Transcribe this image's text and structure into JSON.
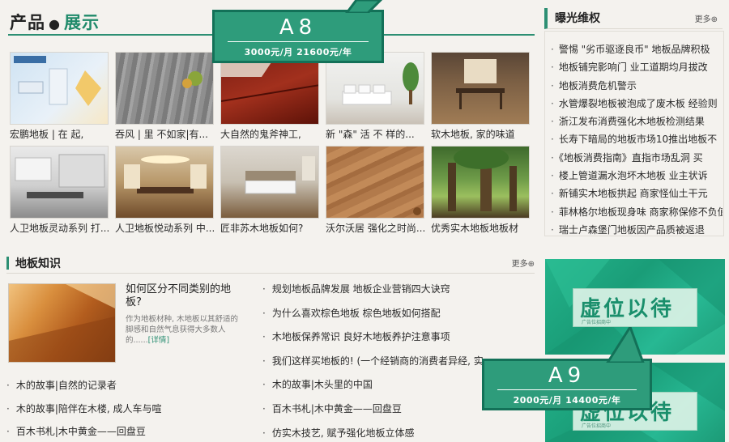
{
  "products": {
    "title_part1": "产品",
    "title_dot": "●",
    "title_part2": "展示",
    "items": [
      {
        "caption": "宏鹏地板 | 在  起,",
        "image": "room-photo-1"
      },
      {
        "caption": "吞风 | 里 不如家|有...",
        "image": "grey-wood-planks"
      },
      {
        "caption": "大自然的鬼斧神工,",
        "image": "red-wood-floor"
      },
      {
        "caption": "新 \"森\" 活 不 样的...",
        "image": "white-living-room"
      },
      {
        "caption": "软木地板, 家的味道",
        "image": "dining-room-wood"
      },
      {
        "caption": "人卫地板灵动系列 打...",
        "image": "kitchen-room"
      },
      {
        "caption": "人卫地板悦动系列 中...",
        "image": "dining-hall"
      },
      {
        "caption": "匠非苏木地板如何?",
        "image": "bedroom-wood"
      },
      {
        "caption": "沃尔沃居 强化之时尚...",
        "image": "oak-texture"
      },
      {
        "caption": "优秀实木地板地板材",
        "image": "forest-trees"
      }
    ]
  },
  "exposure": {
    "title": "曝光维权",
    "more": "更多⊕",
    "items": [
      "警惕 \"劣币驱逐良币\" 地板品牌积极",
      "地板铺完影响门 业工道期均月拔改",
      "地板消费危机警示",
      "水管爆裂地板被泡成了废木板 经验则",
      "浙江发布消费强化木地板检测结果",
      "长寿下暗局的地板市场10推出地板不",
      "《地板消费指南》直指市场乱洞 买",
      "楼上管道漏水泡坏木地板 业主状诉",
      "新铺实木地板拱起 商家怪仙土干元",
      "菲林格尔地板现身味 商家称保修不负值",
      "瑞士卢森堡门地板因产品质被返退"
    ]
  },
  "knowledge": {
    "title": "地板知识",
    "more": "更多⊕",
    "featured": {
      "title": "如何区分不同类别的地板?",
      "desc": "作为地板材种, 木地板以其舒适的脚感和自然气息获得大多数人的......",
      "detail": "[详情]"
    },
    "left_items": [
      "木的故事|自然的记录者",
      "木的故事|陪伴在木楼, 成人车与喧",
      "百木书札|木中黄金——回盘豆"
    ],
    "right_items": [
      "规划地板品牌发展 地板企业营销四大诀窍",
      "为什么喜欢棕色地板 棕色地板如何搭配",
      "木地板保养常识 良好木地板养护注意事项",
      "我们这样买地板的! (一个经销商的消费者异经, 实",
      "木的故事|木头里的中国",
      "百木书札|木中黄金——回盘豆",
      "仿实木技艺, 赋予强化地板立体感"
    ]
  },
  "ads": {
    "slot_text": "虚位以待",
    "slot_small": "广告位招商中",
    "a8": {
      "code": "A8",
      "price": "3000元/月 21600元/年"
    },
    "a9": {
      "code": "A9",
      "price": "2000元/月 14400元/年"
    }
  },
  "colors": {
    "accent": "#2c8f73",
    "callout": "#2e9c7b",
    "ad_green": "#1fa884"
  }
}
